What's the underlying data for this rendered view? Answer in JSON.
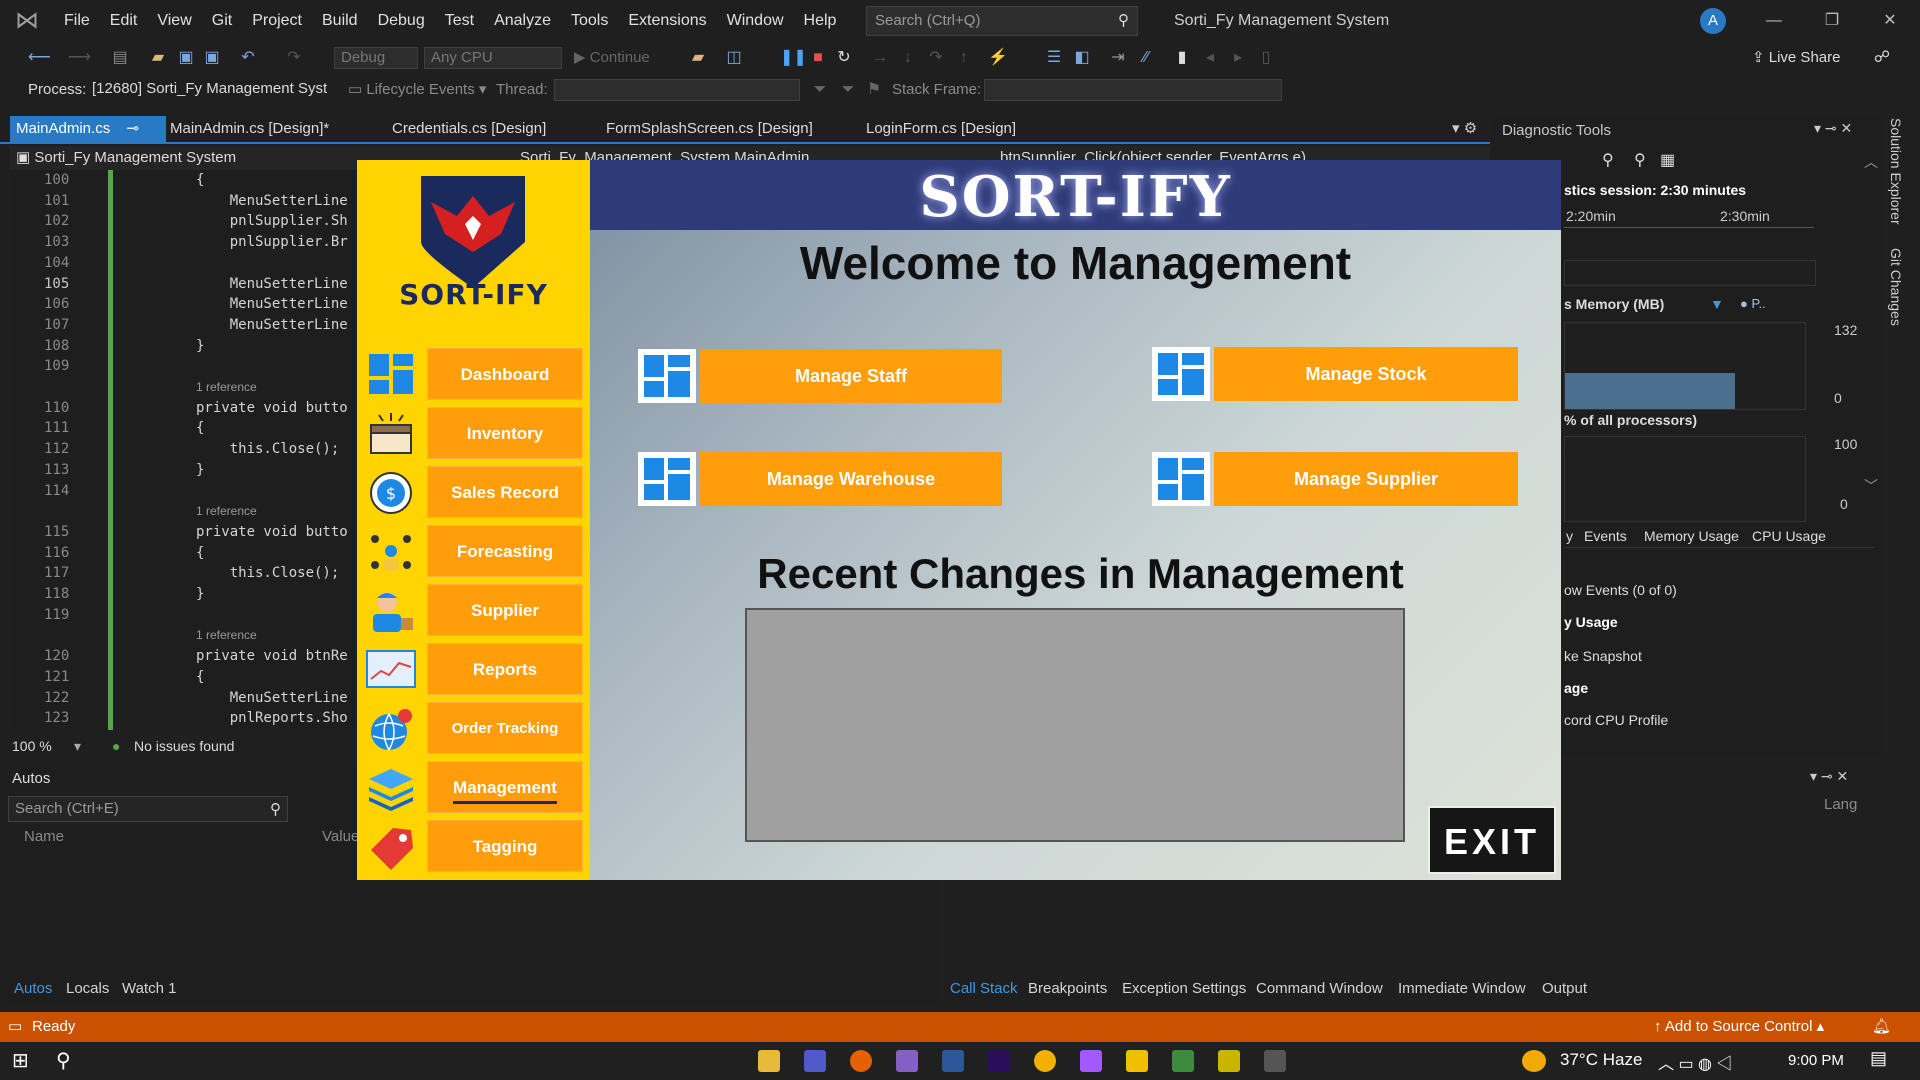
{
  "menubar": {
    "items": [
      "File",
      "Edit",
      "View",
      "Git",
      "Project",
      "Build",
      "Debug",
      "Test",
      "Analyze",
      "Tools",
      "Extensions",
      "Window",
      "Help"
    ],
    "search_placeholder": "Search (Ctrl+Q)",
    "solution_title": "Sorti_Fy Management System",
    "avatar": "A"
  },
  "toolbar": {
    "config": "Debug",
    "platform": "Any CPU",
    "continue": "Continue",
    "live_share": "Live Share",
    "process_label": "Process:",
    "process_value": "[12680] Sorti_Fy Management Syst",
    "lifecycle": "Lifecycle Events",
    "thread_label": "Thread:",
    "stackframe_label": "Stack Frame:"
  },
  "doc_tabs": [
    "MainAdmin.cs",
    "MainAdmin.cs [Design]*",
    "Credentials.cs [Design]",
    "FormSplashScreen.cs [Design]",
    "LoginForm.cs [Design]"
  ],
  "nav_bar": {
    "project": "Sorti_Fy Management System",
    "class": "Sorti_Fy_Management_System.MainAdmin",
    "member": "btnSupplier_Click(object sender, EventArgs e)"
  },
  "code": [
    {
      "n": "100",
      "t": "{"
    },
    {
      "n": "101",
      "t": "    MenuSetterLine"
    },
    {
      "n": "102",
      "t": "    pnlSupplier.Sh"
    },
    {
      "n": "103",
      "t": "    pnlSupplier.Br"
    },
    {
      "n": "104",
      "t": ""
    },
    {
      "n": "105",
      "t": "    MenuSetterLine"
    },
    {
      "n": "106",
      "t": "    MenuSetterLine"
    },
    {
      "n": "107",
      "t": "    MenuSetterLine"
    },
    {
      "n": "108",
      "t": "}"
    },
    {
      "n": "109",
      "t": ""
    },
    {
      "n": "",
      "ref": "1 reference"
    },
    {
      "n": "110",
      "t": "private void butto"
    },
    {
      "n": "111",
      "t": "{"
    },
    {
      "n": "112",
      "t": "    this.Close();"
    },
    {
      "n": "113",
      "t": "}"
    },
    {
      "n": "114",
      "t": ""
    },
    {
      "n": "",
      "ref": "1 reference"
    },
    {
      "n": "115",
      "t": "private void butto"
    },
    {
      "n": "116",
      "t": "{"
    },
    {
      "n": "117",
      "t": "    this.Close();"
    },
    {
      "n": "118",
      "t": "}"
    },
    {
      "n": "119",
      "t": ""
    },
    {
      "n": "",
      "ref": "1 reference"
    },
    {
      "n": "120",
      "t": "private void btnRe"
    },
    {
      "n": "121",
      "t": "{"
    },
    {
      "n": "122",
      "t": "    MenuSetterLine"
    },
    {
      "n": "123",
      "t": "    pnlReports.Sho"
    }
  ],
  "editor_status": {
    "zoom": "100 %",
    "issues": "No issues found"
  },
  "autos": {
    "title": "Autos",
    "search_placeholder": "Search (Ctrl+E)",
    "col_name": "Name",
    "col_value": "Value",
    "col_lang": "Lang"
  },
  "bottom_left_tabs": [
    "Autos",
    "Locals",
    "Watch 1"
  ],
  "bottom_right_tabs": [
    "Call Stack",
    "Breakpoints",
    "Exception Settings",
    "Command Window",
    "Immediate Window",
    "Output"
  ],
  "diagnostic": {
    "title": "Diagnostic Tools",
    "session": "stics session: 2:30 minutes",
    "t1": "2:20min",
    "t2": "2:30min",
    "memory": "s Memory (MB)",
    "legend": "P..",
    "mem_max": "132",
    "mem_min": "0",
    "cpu": "% of all processors)",
    "cpu_max": "100",
    "cpu_min": "0",
    "tabs": [
      "y",
      "Events",
      "Memory Usage",
      "CPU Usage"
    ],
    "rows": [
      "ow Events (0 of 0)",
      "y Usage",
      "ke Snapshot",
      "age",
      "cord CPU Profile"
    ]
  },
  "side_labels": [
    "Solution Explorer",
    "Git Changes"
  ],
  "statusbar": {
    "ready": "Ready",
    "source_control": "Add to Source Control"
  },
  "taskbar": {
    "weather": "37°C  Haze",
    "time": "9:00 PM"
  },
  "app": {
    "header": "SORT-IFY",
    "logo_text": "SORT-IFY",
    "welcome": "Welcome to Management",
    "nav": [
      {
        "label": "Dashboard",
        "icon": "dashboard-icon"
      },
      {
        "label": "Inventory",
        "icon": "box-icon"
      },
      {
        "label": "Sales Record",
        "icon": "dollar-coin-icon"
      },
      {
        "label": "Forecasting",
        "icon": "network-people-icon"
      },
      {
        "label": "Supplier",
        "icon": "worker-icon"
      },
      {
        "label": "Reports",
        "icon": "chart-icon"
      },
      {
        "label": "Order Tracking",
        "icon": "globe-icon"
      },
      {
        "label": "Management",
        "icon": "layers-icon"
      },
      {
        "label": "Tagging",
        "icon": "tag-icon"
      }
    ],
    "active_nav": "Management",
    "cards": [
      "Manage Staff",
      "Manage Stock",
      "Manage Warehouse",
      "Manage Supplier"
    ],
    "recent_title": "Recent Changes in Management",
    "exit": "EXIT",
    "colors": {
      "sidebar": "#ffd400",
      "button": "#ff9d0b",
      "header": "#2f3b78",
      "dark": "#1b2a5c"
    }
  }
}
